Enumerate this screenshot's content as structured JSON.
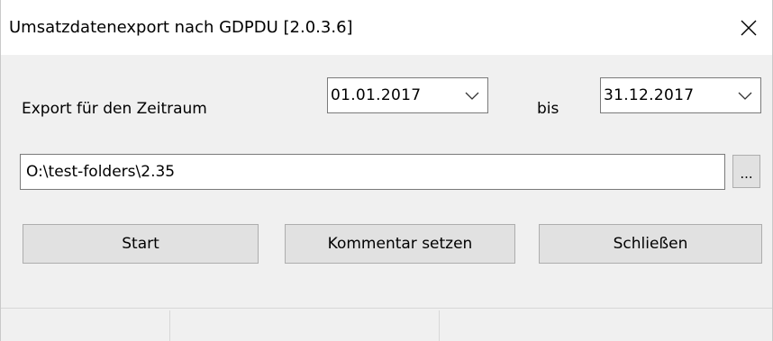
{
  "window": {
    "title": "Umsatzdatenexport nach GDPDU [2.0.3.6]",
    "close_icon": "close-icon"
  },
  "period": {
    "label": "Export für den Zeitraum",
    "from_date": "01.01.2017",
    "to_label": "bis",
    "to_date": "31.12.2017",
    "dropdown_icon": "chevron-down-icon"
  },
  "path": {
    "value": "O:\\test-folders\\2.35",
    "browse_label": "..."
  },
  "buttons": {
    "start_label": "Start",
    "comment_label": "Kommentar setzen",
    "close_label": "Schließen"
  },
  "statusbar": {
    "panels": [
      "",
      "",
      ""
    ]
  },
  "colors": {
    "window_bg": "#f0f0f0",
    "titlebar_bg": "#ffffff",
    "button_bg": "#e1e1e1",
    "border": "#7a7a7a"
  }
}
